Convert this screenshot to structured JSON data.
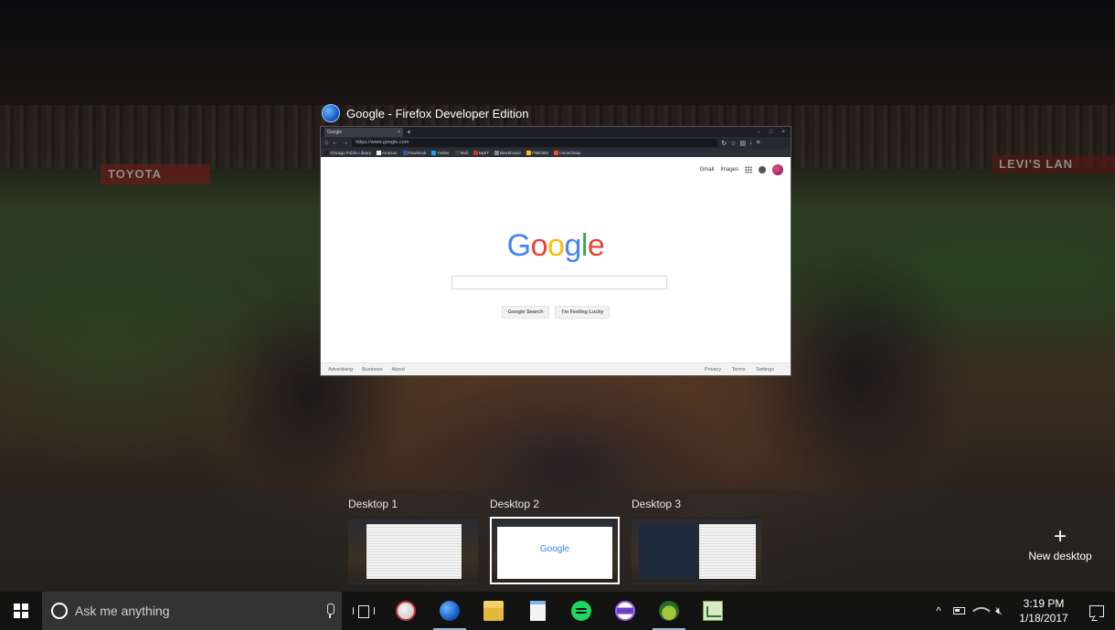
{
  "window": {
    "title": "Google - Firefox Developer Edition",
    "tab_title": "Google",
    "url": "https://www.google.com",
    "bookmarks": [
      "Chicago Public Library",
      "Amazon",
      "Facebook",
      "Twitter",
      "Mail",
      "MyIIT",
      "Blackboard",
      "ITMD362",
      "namecheap"
    ],
    "bookmark_colors": [
      "#222222",
      "#f0f0f0",
      "#3b5998",
      "#1da1f2",
      "#444444",
      "#c0392b",
      "#888888",
      "#f1c40f",
      "#e8542a"
    ]
  },
  "google": {
    "top_links": [
      "Gmail",
      "Images"
    ],
    "logo_letters": [
      "G",
      "o",
      "o",
      "g",
      "l",
      "e"
    ],
    "logo_colors": [
      "#4285f4",
      "#ea4335",
      "#fbbc05",
      "#4285f4",
      "#34a853",
      "#ea4335"
    ],
    "search_button": "Google Search",
    "lucky_button": "I'm Feeling Lucky",
    "footer_left": [
      "Advertising",
      "Business",
      "About"
    ],
    "footer_right": [
      "Privacy",
      "Terms",
      "Settings"
    ]
  },
  "task_view": {
    "desktops": [
      {
        "label": "Desktop 1",
        "active": false
      },
      {
        "label": "Desktop 2",
        "active": true
      },
      {
        "label": "Desktop 3",
        "active": false
      }
    ],
    "mini_logo": "Google",
    "new_desktop_label": "New desktop",
    "new_desktop_symbol": "+"
  },
  "wallpaper": {
    "banner_left": "TOYOTA",
    "banner_right": "LEVI'S LAN"
  },
  "taskbar": {
    "search_placeholder": "Ask me anything",
    "pinned_apps": [
      "snipping-tool",
      "firefox-developer-edition",
      "file-explorer",
      "notepad",
      "spotify",
      "visual-studio",
      "android-studio",
      "chart-app"
    ],
    "tray_chevron": "^",
    "time": "3:19 PM",
    "date": "1/18/2017",
    "accent_color": "#9ab8d8"
  }
}
